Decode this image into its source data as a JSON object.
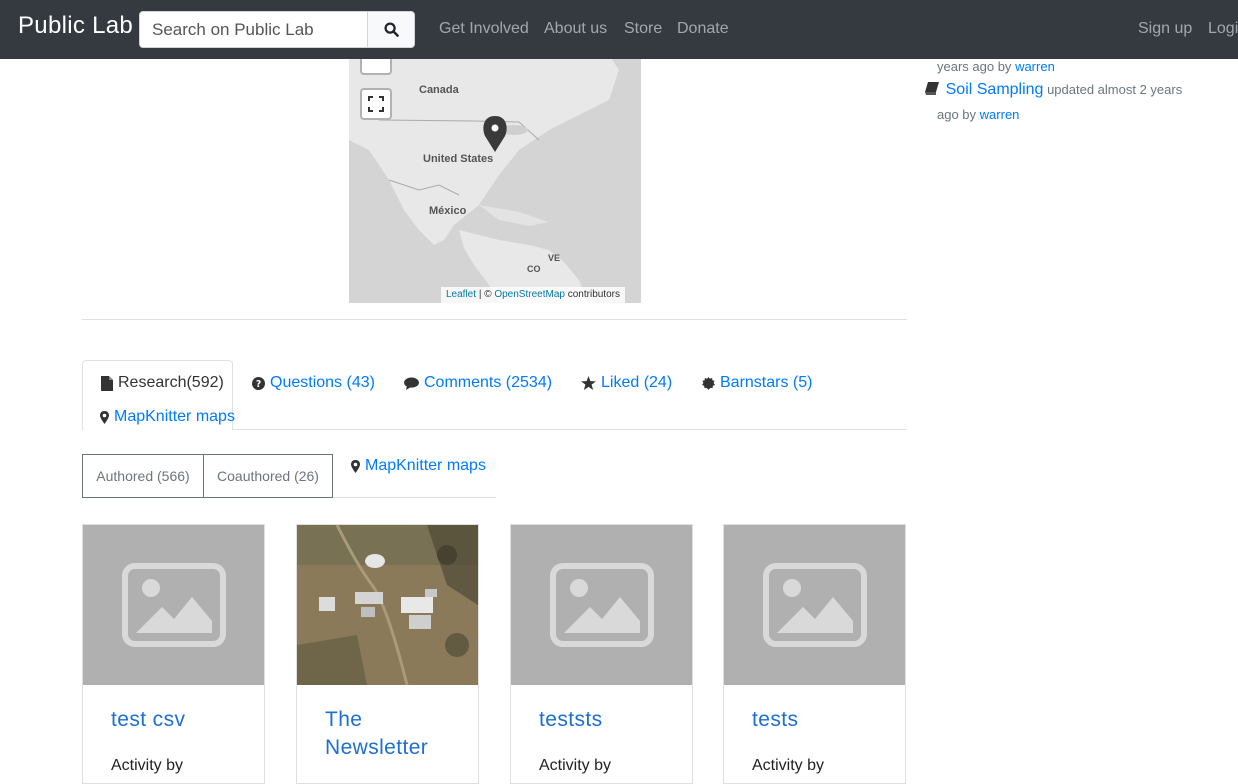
{
  "navbar": {
    "brand": "Public Lab",
    "search_placeholder": "Search on Public Lab",
    "links": [
      "Get Involved",
      "About us",
      "Store",
      "Donate"
    ],
    "signup": "Sign up",
    "login": "Login"
  },
  "map": {
    "labels": {
      "canada": "Canada",
      "us": "United States",
      "mexico": "México",
      "ve": "VE",
      "co": "CO"
    },
    "attribution": {
      "leaflet": "Leaflet",
      "sep": "| ©",
      "osm": "OpenStreetMap",
      "contributors": "contributors"
    }
  },
  "sidebar": {
    "item1_meta": "years ago by",
    "item1_author": "warren",
    "item2_title": "Soil Sampling",
    "item2_meta_1": "updated almost 2 years",
    "item2_meta_2": "ago by",
    "item2_author": "warren"
  },
  "tabs": {
    "research": "Research(592)",
    "questions": "Questions (43)",
    "comments": "Comments (2534)",
    "liked": "Liked (24)",
    "barnstars": "Barnstars (5)",
    "mapknitter": "MapKnitter maps"
  },
  "subtabs": {
    "authored": "Authored (566)",
    "coauthored": "Coauthored (26)",
    "mapknitter": "MapKnitter maps"
  },
  "cards": [
    {
      "title": "test csv",
      "sub": "Activity by"
    },
    {
      "title": "The Newsletter",
      "sub": ""
    },
    {
      "title": "teststs",
      "sub": "Activity by"
    },
    {
      "title": "tests",
      "sub": "Activity by"
    }
  ],
  "colors": {
    "navbar": "#343a40",
    "link": "#007bff",
    "card_title": "#1c6fd3"
  }
}
